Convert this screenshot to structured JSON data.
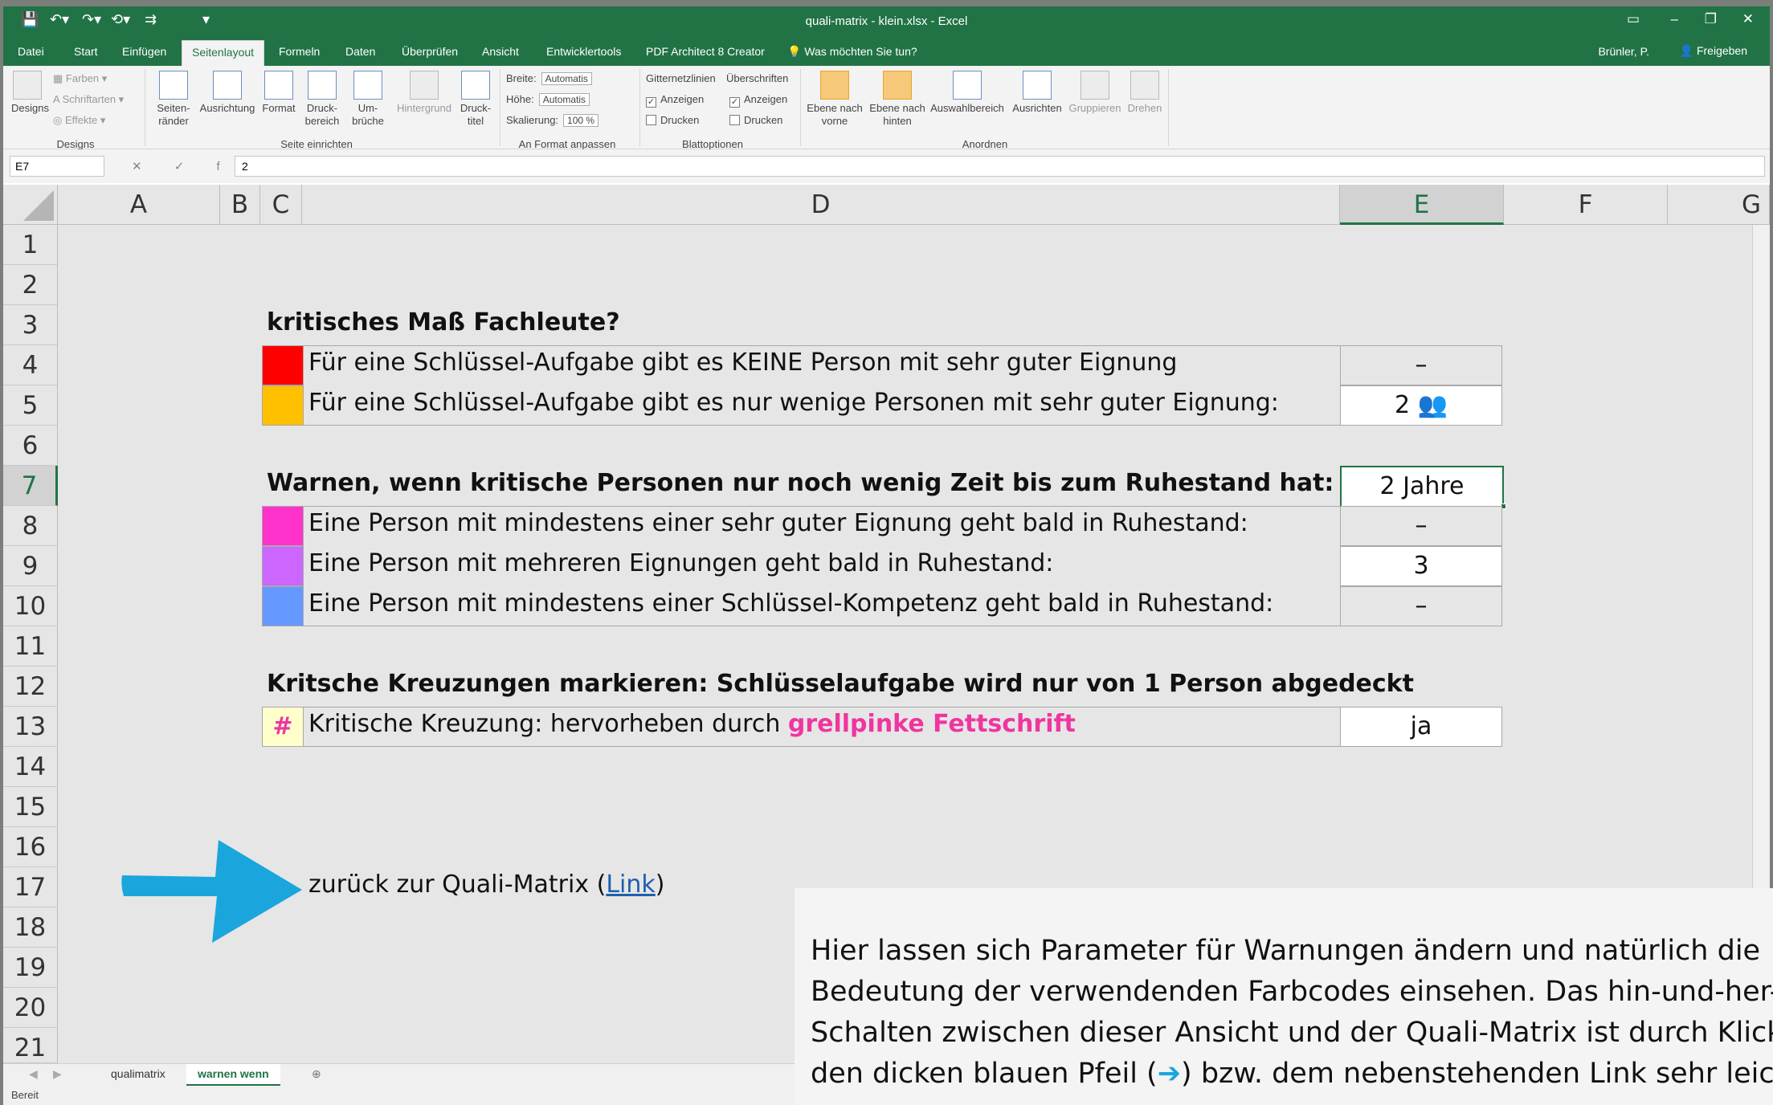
{
  "window": {
    "title": "quali-matrix - klein.xlsx - Excel",
    "controls": {
      "ribbon_opts": "▭",
      "minimize": "–",
      "restore": "❐",
      "close": "✕"
    }
  },
  "quick_access": {
    "save": "💾",
    "undo": "↶▾",
    "redo": "↷▾",
    "form": "⟲▾",
    "more": "⇉",
    "cust": "▾"
  },
  "tabs": [
    "Datei",
    "Start",
    "Einfügen",
    "Seitenlayout",
    "Formeln",
    "Daten",
    "Überprüfen",
    "Ansicht",
    "Entwicklertools",
    "PDF Architect 8 Creator",
    "Was möchten Sie tun?"
  ],
  "active_tab": "Seitenlayout",
  "user": "Brünler, P.",
  "share": "Freigeben",
  "ribbon": {
    "designs": {
      "big": "Designs",
      "farben": "Farben",
      "schriftarten": "Schriftarten",
      "effekte": "Effekte",
      "group": "Designs"
    },
    "seite": {
      "raender": "Seiten-\nränder",
      "ausrichtung": "Ausrichtung",
      "format": "Format",
      "druckbereich": "Druck-\nbereich",
      "umbrueche": "Um-\nbrüche",
      "hintergrund": "Hintergrund",
      "drucktitel": "Druck-\ntitel",
      "group": "Seite einrichten"
    },
    "anpassen": {
      "breite": "Breite:",
      "breite_val": "Automatis",
      "hoehe": "Höhe:",
      "hoehe_val": "Automatis",
      "skalierung": "Skalierung:",
      "skal_val": "100 %",
      "group": "An Format anpassen"
    },
    "blatt": {
      "gitter": "Gitternetzlinien",
      "ueberschriften": "Überschriften",
      "anzeigen": "Anzeigen",
      "drucken": "Drucken",
      "group": "Blattoptionen"
    },
    "anordnen": {
      "vorne": "Ebene nach\nvorne",
      "hinten": "Ebene nach\nhinten",
      "auswahl": "Auswahlbereich",
      "ausrichten": "Ausrichten",
      "gruppieren": "Gruppieren",
      "drehen": "Drehen",
      "group": "Anordnen"
    }
  },
  "formula_bar": {
    "name_box": "E7",
    "formula": "2",
    "fx": "✕ ✓ fx"
  },
  "columns": [
    "A",
    "B",
    "C",
    "D",
    "E",
    "F",
    "G"
  ],
  "rows": [
    "1",
    "2",
    "3",
    "4",
    "5",
    "6",
    "7",
    "8",
    "9",
    "10",
    "11",
    "12",
    "13",
    "14",
    "15",
    "16",
    "17",
    "18",
    "19",
    "20",
    "21"
  ],
  "content": {
    "h1": "kritisches Maß Fachleute?",
    "r4": "Für eine Schlüssel-Aufgabe gibt es KEINE Person mit sehr guter Eignung",
    "r4_pre": "Für eine Schlüssel-Aufgabe gibt es ",
    "r4_keine": "KEINE",
    "r4_post": " Person mit sehr guter Eignung",
    "r4_val": "–",
    "r5": "Für eine Schlüssel-Aufgabe gibt es nur wenige Personen mit sehr guter Eignung:",
    "r5_val": "2",
    "r5_icon": "👥",
    "h2": "Warnen, wenn kritische Personen nur noch wenig Zeit bis zum Ruhestand hat:",
    "r7_val": "2 Jahre",
    "r8": "Eine Person mit mindestens einer sehr guter Eignung geht bald in Ruhestand:",
    "r8_val": "–",
    "r9": "Eine Person mit mehreren Eignungen geht bald in Ruhestand:",
    "r9_val": "3",
    "r10": "Eine Person mit mindestens einer Schlüssel-Kompetenz geht bald in Ruhestand:",
    "r10_val": "–",
    "h3": "Kritsche Kreuzungen markieren: Schlüsselaufgabe wird nur von 1 Person abgedeckt",
    "r13_mark": "#",
    "r13_pre": "Kritische Kreuzung: hervorheben durch ",
    "r13_pink": "grellpinke Fettschrift",
    "r13_val": "ja",
    "back_pre": "zurück zur Quali-Matrix (",
    "back_link": "Link",
    "back_post": ")"
  },
  "swatch_colors": {
    "r4": "#ff0000",
    "r5": "#ffc000",
    "r8": "#ff33cc",
    "r9": "#cc66ff",
    "r10": "#6699ff",
    "r13": "#ffffcc"
  },
  "sheets": [
    "qualimatrix",
    "warnen wenn"
  ],
  "active_sheet": "warnen wenn",
  "status": "Bereit",
  "overlay": {
    "line1": "Hier lassen sich Parameter für Warnungen ändern und natürlich die",
    "line2": "Bedeutung der verwendenden Farbcodes einsehen. Das hin-und-her-",
    "line3": "Schalten zwischen dieser Ansicht und der Quali-Matrix ist durch Klick",
    "line4_pre": "den dicken blauen Pfeil (",
    "arrow": "➔",
    "line4_post": ") bzw. dem nebenstehenden Link sehr leich"
  }
}
